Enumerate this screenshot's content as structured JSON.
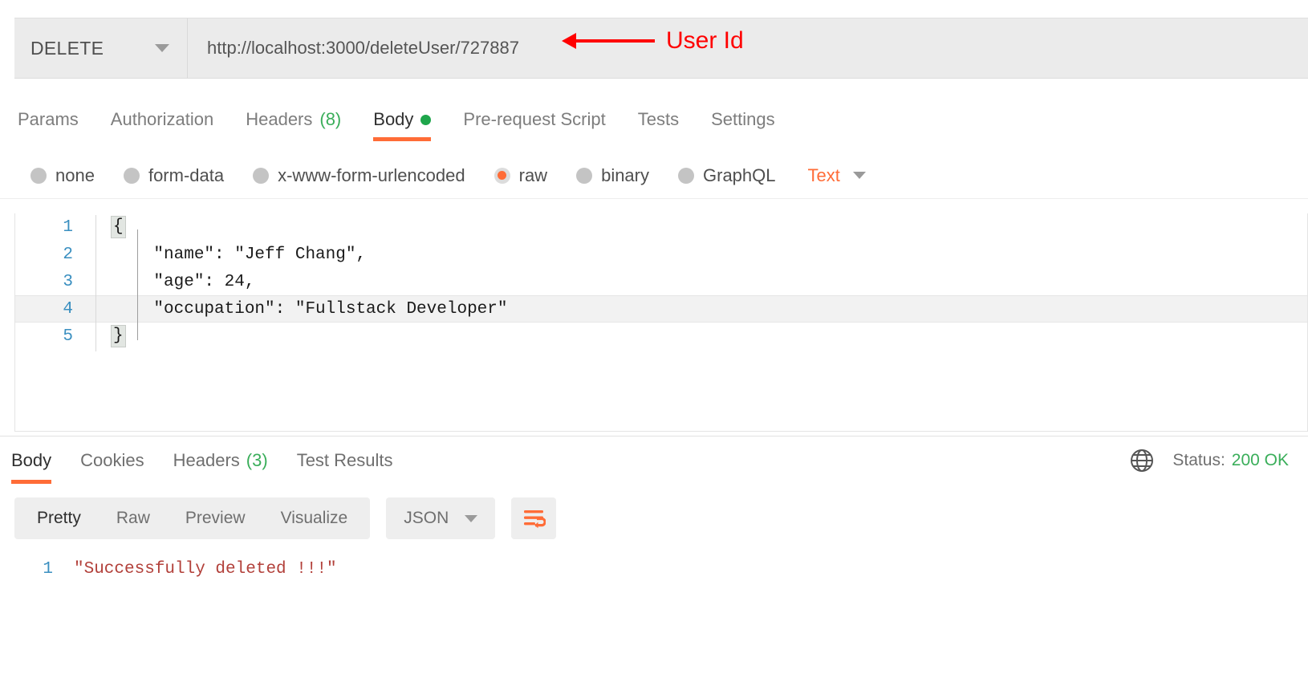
{
  "request": {
    "method": "DELETE",
    "url": "http://localhost:3000/deleteUser/727887",
    "annotation": "User Id",
    "tabs": [
      {
        "label": "Params",
        "badge": "",
        "active": false,
        "dot": false
      },
      {
        "label": "Authorization",
        "badge": "",
        "active": false,
        "dot": false
      },
      {
        "label": "Headers",
        "badge": "(8)",
        "active": false,
        "dot": false
      },
      {
        "label": "Body",
        "badge": "",
        "active": true,
        "dot": true
      },
      {
        "label": "Pre-request Script",
        "badge": "",
        "active": false,
        "dot": false
      },
      {
        "label": "Tests",
        "badge": "",
        "active": false,
        "dot": false
      },
      {
        "label": "Settings",
        "badge": "",
        "active": false,
        "dot": false
      }
    ],
    "body_types": [
      {
        "label": "none",
        "selected": false
      },
      {
        "label": "form-data",
        "selected": false
      },
      {
        "label": "x-www-form-urlencoded",
        "selected": false
      },
      {
        "label": "raw",
        "selected": true
      },
      {
        "label": "binary",
        "selected": false
      },
      {
        "label": "GraphQL",
        "selected": false
      }
    ],
    "language": "Text",
    "body_lines": [
      {
        "number": "1",
        "text": "{",
        "active": false
      },
      {
        "number": "2",
        "text": "    \"name\": \"Jeff Chang\",",
        "active": false
      },
      {
        "number": "3",
        "text": "    \"age\": 24,",
        "active": false
      },
      {
        "number": "4",
        "text": "    \"occupation\": \"Fullstack Developer\"",
        "active": true
      },
      {
        "number": "5",
        "text": "}",
        "active": false
      }
    ]
  },
  "response": {
    "tabs": [
      {
        "label": "Body",
        "badge": "",
        "active": true
      },
      {
        "label": "Cookies",
        "badge": "",
        "active": false
      },
      {
        "label": "Headers",
        "badge": "(3)",
        "active": false
      },
      {
        "label": "Test Results",
        "badge": "",
        "active": false
      }
    ],
    "status_label": "Status:",
    "status_value": "200 OK",
    "view_modes": [
      {
        "label": "Pretty",
        "active": true
      },
      {
        "label": "Raw",
        "active": false
      },
      {
        "label": "Preview",
        "active": false
      },
      {
        "label": "Visualize",
        "active": false
      }
    ],
    "format": "JSON",
    "body_lines": [
      {
        "number": "1",
        "text": "\"Successfully deleted !!!\""
      }
    ]
  },
  "colors": {
    "accent": "#ff6c37",
    "success": "#3aae5a",
    "annotation": "#ff0000",
    "string": "#b2403a",
    "linenumber": "#3a8fc0"
  }
}
